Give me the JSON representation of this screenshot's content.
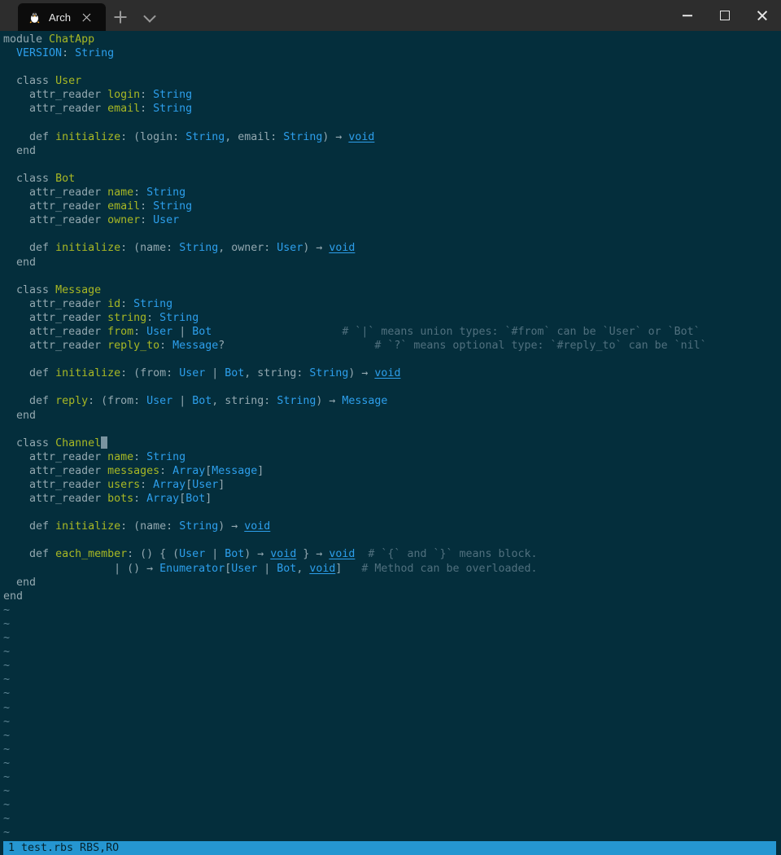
{
  "window": {
    "tab": {
      "title": "Arch",
      "icon": "tux-penguin-icon",
      "close_icon": "close-icon"
    },
    "new_tab_icon": "plus-icon",
    "tab_menu_icon": "chevron-down-icon",
    "controls": {
      "minimize": "minimize-icon",
      "maximize": "maximize-icon",
      "close": "close-icon"
    },
    "colors": {
      "titlebar": "#2D2D2D",
      "active_tab": "#0C0C0C",
      "terminal_bg": "#042E3C",
      "status_bg": "#2596D1",
      "accent_type": "#2D9FEC",
      "accent_identifier": "#A8B824",
      "comment": "#50707E",
      "cursor": "#7A94A0"
    }
  },
  "statusbar": {
    "text": "1 test.rbs RBS,RO"
  },
  "editor": {
    "cursor": {
      "line": 31,
      "column": 15
    },
    "tilde_char": "~",
    "tilde_count": 17,
    "lines": [
      [
        {
          "t": "kw",
          "v": "module "
        },
        {
          "t": "id",
          "v": "ChatApp"
        }
      ],
      [
        {
          "t": "plain",
          "v": "  "
        },
        {
          "t": "type",
          "v": "VERSION"
        },
        {
          "t": "punc",
          "v": ": "
        },
        {
          "t": "type",
          "v": "String"
        }
      ],
      [],
      [
        {
          "t": "plain",
          "v": "  "
        },
        {
          "t": "kw",
          "v": "class "
        },
        {
          "t": "id",
          "v": "User"
        }
      ],
      [
        {
          "t": "plain",
          "v": "    "
        },
        {
          "t": "kw",
          "v": "attr_reader "
        },
        {
          "t": "id",
          "v": "login"
        },
        {
          "t": "punc",
          "v": ": "
        },
        {
          "t": "type",
          "v": "String"
        }
      ],
      [
        {
          "t": "plain",
          "v": "    "
        },
        {
          "t": "kw",
          "v": "attr_reader "
        },
        {
          "t": "id",
          "v": "email"
        },
        {
          "t": "punc",
          "v": ": "
        },
        {
          "t": "type",
          "v": "String"
        }
      ],
      [],
      [
        {
          "t": "plain",
          "v": "    "
        },
        {
          "t": "kw",
          "v": "def "
        },
        {
          "t": "id",
          "v": "initialize"
        },
        {
          "t": "punc",
          "v": ": (login: "
        },
        {
          "t": "type",
          "v": "String"
        },
        {
          "t": "punc",
          "v": ", email: "
        },
        {
          "t": "type",
          "v": "String"
        },
        {
          "t": "punc",
          "v": ") → "
        },
        {
          "t": "void",
          "v": "void"
        }
      ],
      [
        {
          "t": "plain",
          "v": "  "
        },
        {
          "t": "kw",
          "v": "end"
        }
      ],
      [],
      [
        {
          "t": "plain",
          "v": "  "
        },
        {
          "t": "kw",
          "v": "class "
        },
        {
          "t": "id",
          "v": "Bot"
        }
      ],
      [
        {
          "t": "plain",
          "v": "    "
        },
        {
          "t": "kw",
          "v": "attr_reader "
        },
        {
          "t": "id",
          "v": "name"
        },
        {
          "t": "punc",
          "v": ": "
        },
        {
          "t": "type",
          "v": "String"
        }
      ],
      [
        {
          "t": "plain",
          "v": "    "
        },
        {
          "t": "kw",
          "v": "attr_reader "
        },
        {
          "t": "id",
          "v": "email"
        },
        {
          "t": "punc",
          "v": ": "
        },
        {
          "t": "type",
          "v": "String"
        }
      ],
      [
        {
          "t": "plain",
          "v": "    "
        },
        {
          "t": "kw",
          "v": "attr_reader "
        },
        {
          "t": "id",
          "v": "owner"
        },
        {
          "t": "punc",
          "v": ": "
        },
        {
          "t": "type",
          "v": "User"
        }
      ],
      [],
      [
        {
          "t": "plain",
          "v": "    "
        },
        {
          "t": "kw",
          "v": "def "
        },
        {
          "t": "id",
          "v": "initialize"
        },
        {
          "t": "punc",
          "v": ": (name: "
        },
        {
          "t": "type",
          "v": "String"
        },
        {
          "t": "punc",
          "v": ", owner: "
        },
        {
          "t": "type",
          "v": "User"
        },
        {
          "t": "punc",
          "v": ") → "
        },
        {
          "t": "void",
          "v": "void"
        }
      ],
      [
        {
          "t": "plain",
          "v": "  "
        },
        {
          "t": "kw",
          "v": "end"
        }
      ],
      [],
      [
        {
          "t": "plain",
          "v": "  "
        },
        {
          "t": "kw",
          "v": "class "
        },
        {
          "t": "id",
          "v": "Message"
        }
      ],
      [
        {
          "t": "plain",
          "v": "    "
        },
        {
          "t": "kw",
          "v": "attr_reader "
        },
        {
          "t": "id",
          "v": "id"
        },
        {
          "t": "punc",
          "v": ": "
        },
        {
          "t": "type",
          "v": "String"
        }
      ],
      [
        {
          "t": "plain",
          "v": "    "
        },
        {
          "t": "kw",
          "v": "attr_reader "
        },
        {
          "t": "id",
          "v": "string"
        },
        {
          "t": "punc",
          "v": ": "
        },
        {
          "t": "type",
          "v": "String"
        }
      ],
      [
        {
          "t": "plain",
          "v": "    "
        },
        {
          "t": "kw",
          "v": "attr_reader "
        },
        {
          "t": "id",
          "v": "from"
        },
        {
          "t": "punc",
          "v": ": "
        },
        {
          "t": "type",
          "v": "User"
        },
        {
          "t": "punc",
          "v": " | "
        },
        {
          "t": "type",
          "v": "Bot"
        },
        {
          "t": "plain",
          "v": "                    "
        },
        {
          "t": "com",
          "v": "# `|` means union types: `#from` can be `User` or `Bot`"
        }
      ],
      [
        {
          "t": "plain",
          "v": "    "
        },
        {
          "t": "kw",
          "v": "attr_reader "
        },
        {
          "t": "id",
          "v": "reply_to"
        },
        {
          "t": "punc",
          "v": ": "
        },
        {
          "t": "type",
          "v": "Message"
        },
        {
          "t": "punc",
          "v": "?"
        },
        {
          "t": "plain",
          "v": "                       "
        },
        {
          "t": "com",
          "v": "# `?` means optional type: `#reply_to` can be `nil`"
        }
      ],
      [],
      [
        {
          "t": "plain",
          "v": "    "
        },
        {
          "t": "kw",
          "v": "def "
        },
        {
          "t": "id",
          "v": "initialize"
        },
        {
          "t": "punc",
          "v": ": (from: "
        },
        {
          "t": "type",
          "v": "User"
        },
        {
          "t": "punc",
          "v": " | "
        },
        {
          "t": "type",
          "v": "Bot"
        },
        {
          "t": "punc",
          "v": ", string: "
        },
        {
          "t": "type",
          "v": "String"
        },
        {
          "t": "punc",
          "v": ") → "
        },
        {
          "t": "void",
          "v": "void"
        }
      ],
      [],
      [
        {
          "t": "plain",
          "v": "    "
        },
        {
          "t": "kw",
          "v": "def "
        },
        {
          "t": "id",
          "v": "reply"
        },
        {
          "t": "punc",
          "v": ": (from: "
        },
        {
          "t": "type",
          "v": "User"
        },
        {
          "t": "punc",
          "v": " | "
        },
        {
          "t": "type",
          "v": "Bot"
        },
        {
          "t": "punc",
          "v": ", string: "
        },
        {
          "t": "type",
          "v": "String"
        },
        {
          "t": "punc",
          "v": ") → "
        },
        {
          "t": "type",
          "v": "Message"
        }
      ],
      [
        {
          "t": "plain",
          "v": "  "
        },
        {
          "t": "kw",
          "v": "end"
        }
      ],
      [],
      [
        {
          "t": "plain",
          "v": "  "
        },
        {
          "t": "kw",
          "v": "class "
        },
        {
          "t": "id",
          "v": "Channel"
        },
        {
          "t": "cursor",
          "v": " "
        }
      ],
      [
        {
          "t": "plain",
          "v": "    "
        },
        {
          "t": "kw",
          "v": "attr_reader "
        },
        {
          "t": "id",
          "v": "name"
        },
        {
          "t": "punc",
          "v": ": "
        },
        {
          "t": "type",
          "v": "String"
        }
      ],
      [
        {
          "t": "plain",
          "v": "    "
        },
        {
          "t": "kw",
          "v": "attr_reader "
        },
        {
          "t": "id",
          "v": "messages"
        },
        {
          "t": "punc",
          "v": ": "
        },
        {
          "t": "type",
          "v": "Array"
        },
        {
          "t": "punc",
          "v": "["
        },
        {
          "t": "type",
          "v": "Message"
        },
        {
          "t": "punc",
          "v": "]"
        }
      ],
      [
        {
          "t": "plain",
          "v": "    "
        },
        {
          "t": "kw",
          "v": "attr_reader "
        },
        {
          "t": "id",
          "v": "users"
        },
        {
          "t": "punc",
          "v": ": "
        },
        {
          "t": "type",
          "v": "Array"
        },
        {
          "t": "punc",
          "v": "["
        },
        {
          "t": "type",
          "v": "User"
        },
        {
          "t": "punc",
          "v": "]"
        }
      ],
      [
        {
          "t": "plain",
          "v": "    "
        },
        {
          "t": "kw",
          "v": "attr_reader "
        },
        {
          "t": "id",
          "v": "bots"
        },
        {
          "t": "punc",
          "v": ": "
        },
        {
          "t": "type",
          "v": "Array"
        },
        {
          "t": "punc",
          "v": "["
        },
        {
          "t": "type",
          "v": "Bot"
        },
        {
          "t": "punc",
          "v": "]"
        }
      ],
      [],
      [
        {
          "t": "plain",
          "v": "    "
        },
        {
          "t": "kw",
          "v": "def "
        },
        {
          "t": "id",
          "v": "initialize"
        },
        {
          "t": "punc",
          "v": ": (name: "
        },
        {
          "t": "type",
          "v": "String"
        },
        {
          "t": "punc",
          "v": ") → "
        },
        {
          "t": "void",
          "v": "void"
        }
      ],
      [],
      [
        {
          "t": "plain",
          "v": "    "
        },
        {
          "t": "kw",
          "v": "def "
        },
        {
          "t": "id",
          "v": "each_member"
        },
        {
          "t": "punc",
          "v": ": () { ("
        },
        {
          "t": "type",
          "v": "User"
        },
        {
          "t": "punc",
          "v": " | "
        },
        {
          "t": "type",
          "v": "Bot"
        },
        {
          "t": "punc",
          "v": ") → "
        },
        {
          "t": "void",
          "v": "void"
        },
        {
          "t": "punc",
          "v": " } → "
        },
        {
          "t": "void",
          "v": "void"
        },
        {
          "t": "plain",
          "v": "  "
        },
        {
          "t": "com",
          "v": "# `{` and `}` means block."
        }
      ],
      [
        {
          "t": "plain",
          "v": "                 "
        },
        {
          "t": "punc",
          "v": "| () → "
        },
        {
          "t": "type",
          "v": "Enumerator"
        },
        {
          "t": "punc",
          "v": "["
        },
        {
          "t": "type",
          "v": "User"
        },
        {
          "t": "punc",
          "v": " | "
        },
        {
          "t": "type",
          "v": "Bot"
        },
        {
          "t": "punc",
          "v": ", "
        },
        {
          "t": "void",
          "v": "void"
        },
        {
          "t": "punc",
          "v": "]"
        },
        {
          "t": "plain",
          "v": "   "
        },
        {
          "t": "com",
          "v": "# Method can be overloaded."
        }
      ],
      [
        {
          "t": "plain",
          "v": "  "
        },
        {
          "t": "kw",
          "v": "end"
        }
      ],
      [
        {
          "t": "kw",
          "v": "end"
        }
      ]
    ]
  }
}
